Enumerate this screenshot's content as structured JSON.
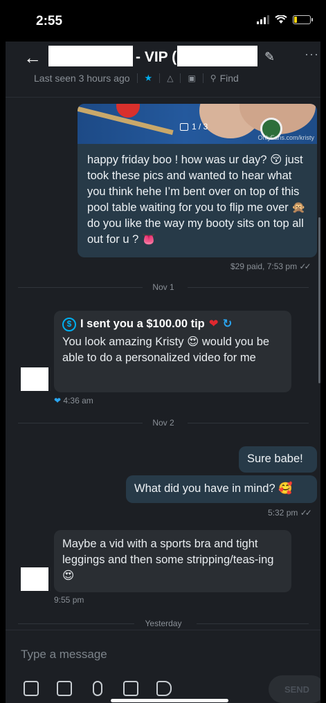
{
  "status": {
    "time": "2:55",
    "battery_level": 0.2
  },
  "header": {
    "title_suffix": "- VIP (",
    "last_seen": "Last seen 3 hours ago",
    "find_label": "Find",
    "icons": [
      "back-arrow-icon",
      "pencil-icon",
      "more-icon",
      "star-icon",
      "bell-icon",
      "gallery-icon",
      "search-icon"
    ]
  },
  "messages": {
    "m1": {
      "media_count": "1 / 3",
      "media_watermark": "OnlyFans.com/kristy",
      "text": "happy friday boo ! how was ur day? 😚 just took these pics and wanted to hear what you think hehe I’m bent over on top of this pool table waiting for you to flip me over 🙊 do you like the way my booty sits on top all out for u ? 👅",
      "meta": "$29 paid, 7:53 pm"
    },
    "divider1": "Nov 1",
    "m2": {
      "tip": "I sent you a $100.00 tip",
      "text": "You look amazing Kristy 😍 would you be able to do a personalized video for me",
      "time": "4:36 am"
    },
    "divider2": "Nov 2",
    "m3": {
      "text": "Sure babe!"
    },
    "m4": {
      "text": "What did you have in mind? 🥰",
      "meta": "5:32 pm"
    },
    "m5": {
      "text": "Maybe a vid with a sports bra and tight leggings and then some stripping/teas-ing 😍",
      "time": "9:55 pm"
    },
    "divider3": "Yesterday"
  },
  "composer": {
    "placeholder": "Type a message",
    "send_label": "SEND",
    "tools": [
      "image-icon",
      "vault-icon",
      "microphone-icon",
      "calendar-icon",
      "price-tag-icon"
    ]
  },
  "colors": {
    "accent": "#00aff0",
    "outgoing_bubble": "#273a48",
    "incoming_bubble": "#2a2e33"
  }
}
